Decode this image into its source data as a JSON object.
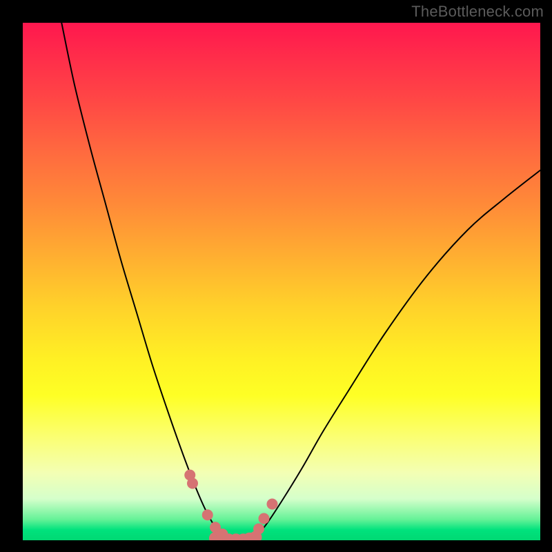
{
  "watermark": "TheBottleneck.com",
  "chart_data": {
    "type": "line",
    "title": "",
    "xlabel": "",
    "ylabel": "",
    "xlim": [
      0,
      1
    ],
    "ylim": [
      0,
      1
    ],
    "series": [
      {
        "name": "left-curve",
        "x": [
          0.075,
          0.1,
          0.13,
          0.16,
          0.19,
          0.22,
          0.25,
          0.28,
          0.31,
          0.335,
          0.355,
          0.375,
          0.39
        ],
        "y": [
          1.0,
          0.88,
          0.76,
          0.65,
          0.54,
          0.44,
          0.34,
          0.25,
          0.165,
          0.1,
          0.055,
          0.02,
          0.0
        ]
      },
      {
        "name": "right-curve",
        "x": [
          0.445,
          0.47,
          0.5,
          0.54,
          0.58,
          0.63,
          0.7,
          0.78,
          0.86,
          0.93,
          1.0
        ],
        "y": [
          0.0,
          0.03,
          0.075,
          0.14,
          0.21,
          0.29,
          0.4,
          0.51,
          0.6,
          0.66,
          0.715
        ]
      },
      {
        "name": "bottom-band-left-dots",
        "x": [
          0.323,
          0.328,
          0.357,
          0.372,
          0.386
        ],
        "y": [
          0.126,
          0.11,
          0.049,
          0.025,
          0.012
        ]
      },
      {
        "name": "bottom-band-right-dots",
        "x": [
          0.456,
          0.466,
          0.482
        ],
        "y": [
          0.022,
          0.042,
          0.07
        ]
      },
      {
        "name": "bottom-band-strip",
        "x": [
          0.372,
          0.384,
          0.398,
          0.412,
          0.426,
          0.438,
          0.45
        ],
        "y": [
          0.004,
          0.002,
          0.001,
          0.001,
          0.001,
          0.003,
          0.006
        ]
      }
    ],
    "colors": {
      "curve": "#000000",
      "marker": "#d67373",
      "gradient_stops": [
        "#ff174e",
        "#ff4745",
        "#ff8a38",
        "#ffd22a",
        "#feff25",
        "#f3ffb4",
        "#64f297",
        "#00d873"
      ]
    }
  }
}
